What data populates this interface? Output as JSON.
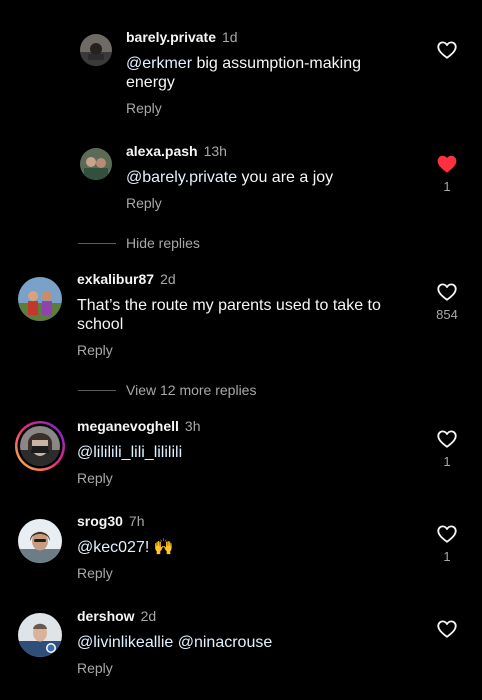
{
  "comments": [
    {
      "username": "barely.private",
      "time": "1d",
      "mention": "@erkmer",
      "text_line1": " big assumption-making",
      "text_line2": "energy",
      "reply_label": "Reply",
      "liked": false,
      "like_count": ""
    },
    {
      "username": "alexa.pash",
      "time": "13h",
      "mention": "@barely.private",
      "text_line1": " you are a joy",
      "reply_label": "Reply",
      "liked": true,
      "like_count": "1"
    },
    {
      "username": "exkalibur87",
      "time": "2d",
      "text_line1": "That’s the route my parents used to take to",
      "text_line2": "school",
      "reply_label": "Reply",
      "liked": false,
      "like_count": "854"
    },
    {
      "username": "meganevoghell",
      "time": "3h",
      "mention": "@lililili_lili_lililili",
      "reply_label": "Reply",
      "liked": false,
      "like_count": "1"
    },
    {
      "username": "srog30",
      "time": "7h",
      "mention": "@kec027!",
      "emoji": "🙌",
      "reply_label": "Reply",
      "liked": false,
      "like_count": "1"
    },
    {
      "username": "dershow",
      "time": "2d",
      "mention": "@livinlikeallie",
      "mention2": "@ninacrouse",
      "reply_label": "Reply",
      "liked": false,
      "like_count": ""
    }
  ],
  "thread_controls": {
    "hide_replies": "Hide replies",
    "view_more": "View 12 more replies"
  },
  "colors": {
    "background": "#000000",
    "text_primary": "#f5f5f5",
    "text_secondary": "#a8a8a8",
    "like_active": "#ff3040",
    "story_ring_start": "#f9ce34",
    "story_ring_mid": "#ee2a7b",
    "story_ring_end": "#6228d7"
  },
  "icons": {
    "like": "heart-outline-icon",
    "liked": "heart-filled-icon"
  }
}
